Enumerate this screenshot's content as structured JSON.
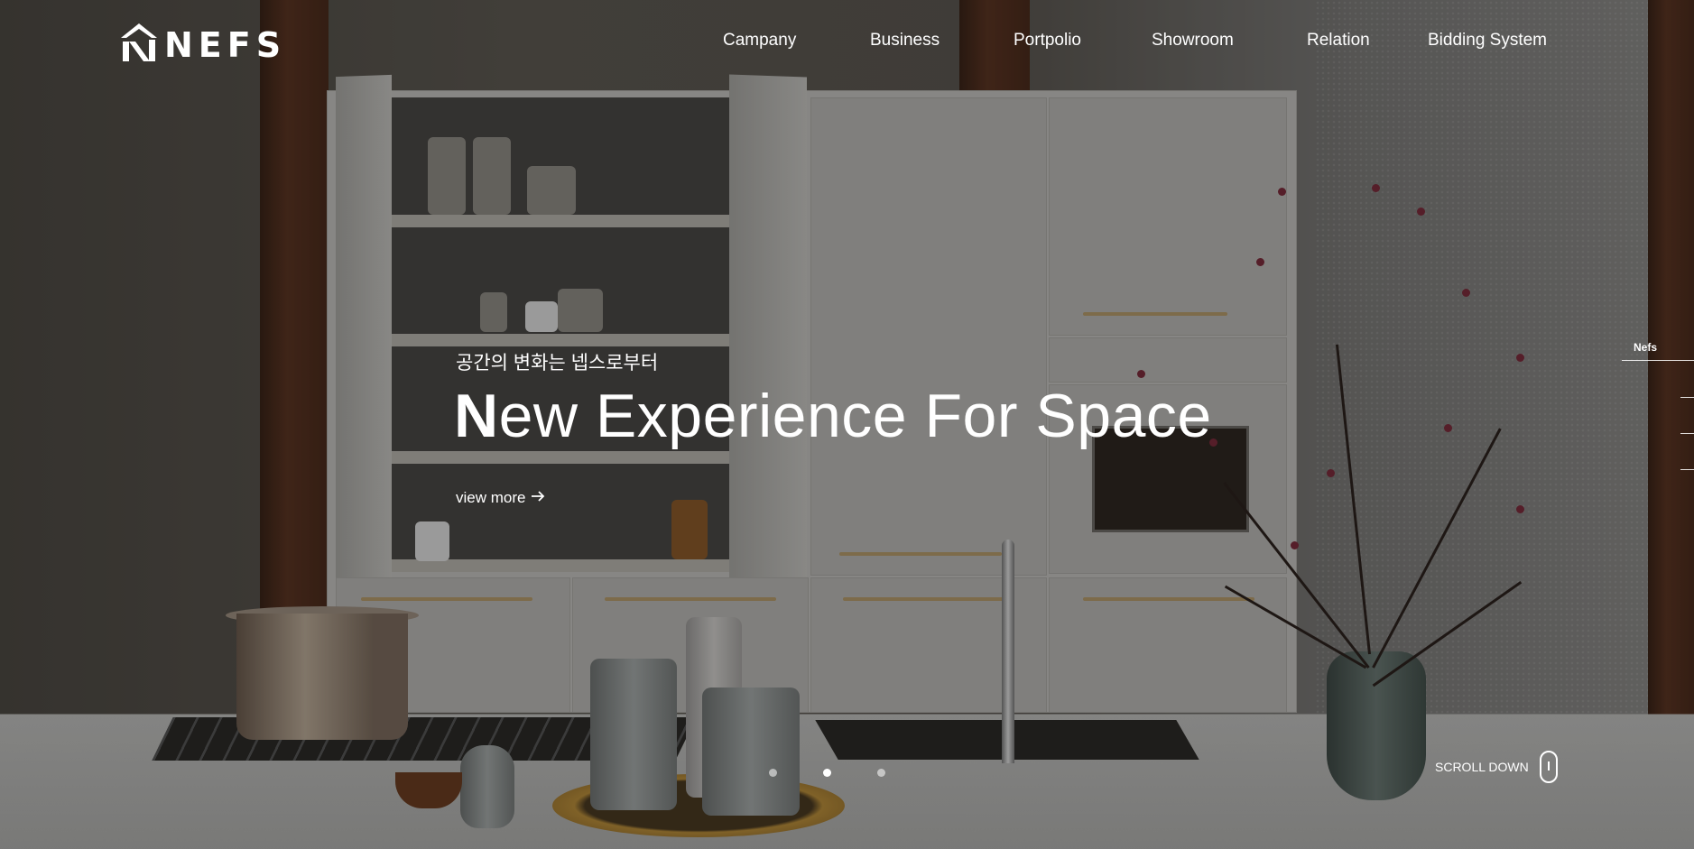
{
  "header": {
    "logo_text": "NEFS",
    "nav": [
      {
        "label": "Campany"
      },
      {
        "label": "Business"
      },
      {
        "label": "Portpolio"
      },
      {
        "label": "Showroom"
      },
      {
        "label": "Relation"
      },
      {
        "label": "Bidding System"
      }
    ]
  },
  "hero": {
    "tagline": "공간의 변화는 넵스로부터",
    "headline_first": "N",
    "headline_rest": "ew Experience For Space",
    "view_more_label": "view more",
    "view_more_icon": "arrow-right-icon"
  },
  "slider": {
    "dot_count": 3,
    "active_index": 1
  },
  "side_indicator": {
    "label": "Nefs"
  },
  "scroll_down": {
    "label": "SCROLL DOWN",
    "icon": "mouse-icon"
  },
  "colors": {
    "text": "#ffffff",
    "overlay": "rgba(0,0,0,0.30)"
  }
}
